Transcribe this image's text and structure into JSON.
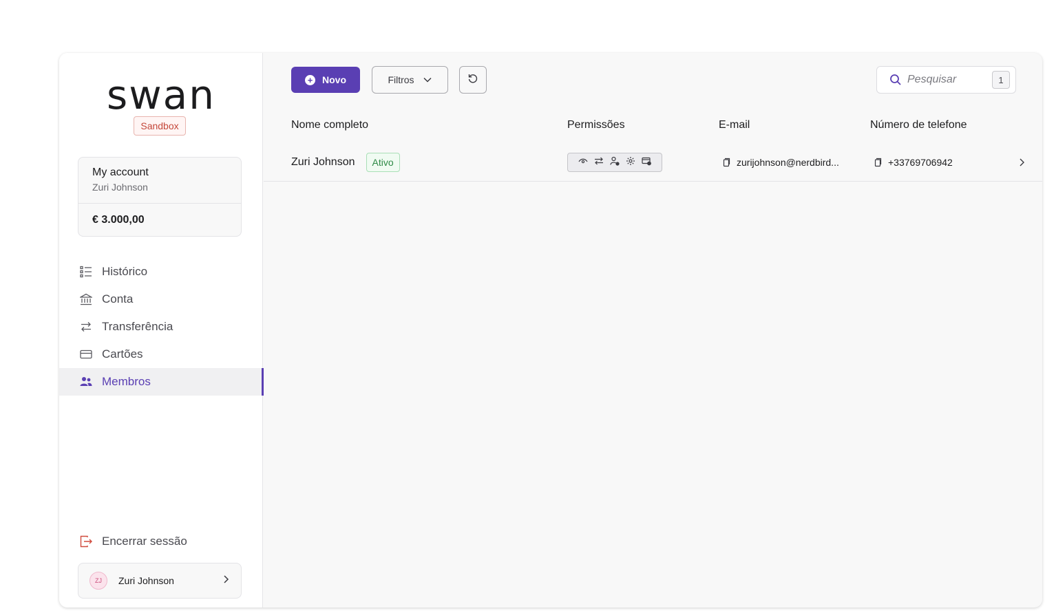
{
  "sidebar": {
    "logo": "swan",
    "environment_badge": "Sandbox",
    "account": {
      "title": "My account",
      "holder": "Zuri Johnson",
      "balance": "€ 3.000,00"
    },
    "nav_items": [
      {
        "label": "Histórico",
        "icon": "list-icon",
        "active": false
      },
      {
        "label": "Conta",
        "icon": "bank-icon",
        "active": false
      },
      {
        "label": "Transferência",
        "icon": "transfer-arrows-icon",
        "active": false
      },
      {
        "label": "Cartões",
        "icon": "card-icon",
        "active": false
      },
      {
        "label": "Membros",
        "icon": "members-icon",
        "active": true
      }
    ],
    "logout_label": "Encerrar sessão",
    "user": {
      "initials": "ZJ",
      "name": "Zuri Johnson"
    }
  },
  "toolbar": {
    "new_label": "Novo",
    "filter_label": "Filtros",
    "search_placeholder": "Pesquisar",
    "search_shortcut": "1"
  },
  "table": {
    "columns": [
      "Nome completo",
      "Permissões",
      "E-mail",
      "Número de telefone"
    ],
    "rows": [
      {
        "name": "Zuri Johnson",
        "status": "Ativo",
        "permissions": [
          "view-icon",
          "transfer-icon",
          "user-manage-icon",
          "settings-icon",
          "card-manage-icon"
        ],
        "email": "zurijohnson@nerdbird...",
        "phone": "+33769706942"
      }
    ]
  },
  "colors": {
    "accent": "#5a3fb3",
    "active_status": "#2e8a46",
    "sandbox": "#c4473a"
  }
}
